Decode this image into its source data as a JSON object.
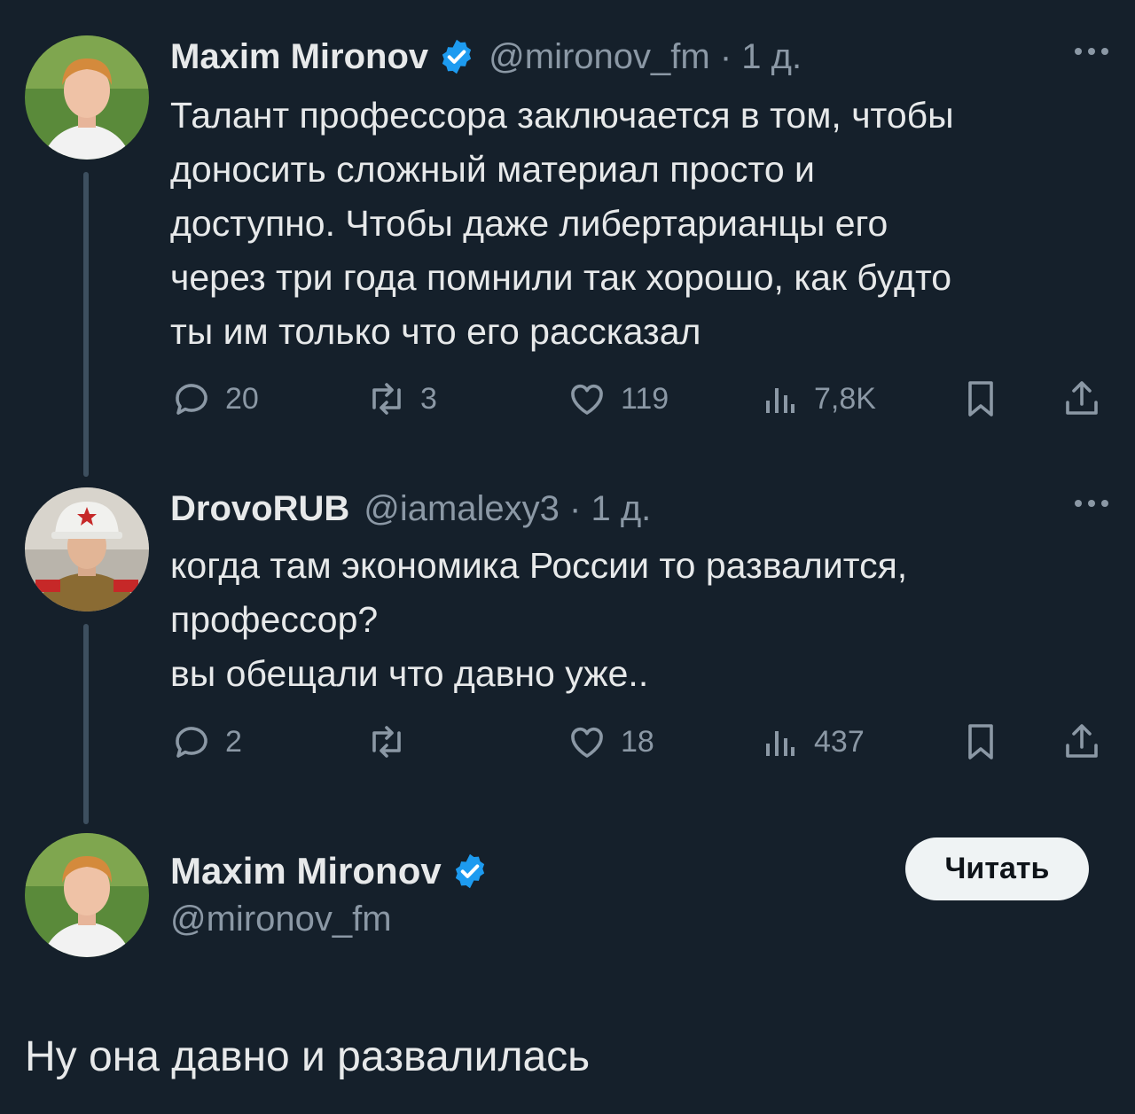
{
  "tweets": [
    {
      "name": "Maxim Mironov",
      "verified": true,
      "handle": "@mironov_fm",
      "time": "1 д.",
      "lines": [
        "Талант профессора заключается в том, чтобы",
        "доносить сложный материал просто и",
        "доступно. Чтобы даже либертарианцы его",
        "через три года помнили так хорошо, как будто",
        "ты им только что его рассказал"
      ],
      "replies": "20",
      "reposts": "3",
      "likes": "119",
      "views": "7,8K"
    },
    {
      "name": "DrovoRUB",
      "verified": false,
      "handle": "@iamalexy3",
      "time": "1 д.",
      "lines": [
        "когда там экономика России то развалится,",
        "профессор?",
        "вы обещали что давно уже.."
      ],
      "replies": "2",
      "reposts": "",
      "likes": "18",
      "views": "437"
    }
  ],
  "focused": {
    "name": "Maxim Mironov",
    "handle": "@mironov_fm",
    "follow_label": "Читать",
    "text": "Ну она давно и развалилась"
  },
  "colors": {
    "background": "#15202b",
    "text": "#e7e9ea",
    "secondary": "#8b98a5",
    "verified": "#1d9bf0",
    "thread_line": "#3d4f5f"
  },
  "icons": [
    "reply-icon",
    "repost-icon",
    "like-icon",
    "views-icon",
    "bookmark-icon",
    "share-icon",
    "verified-badge-icon",
    "more-icon"
  ]
}
